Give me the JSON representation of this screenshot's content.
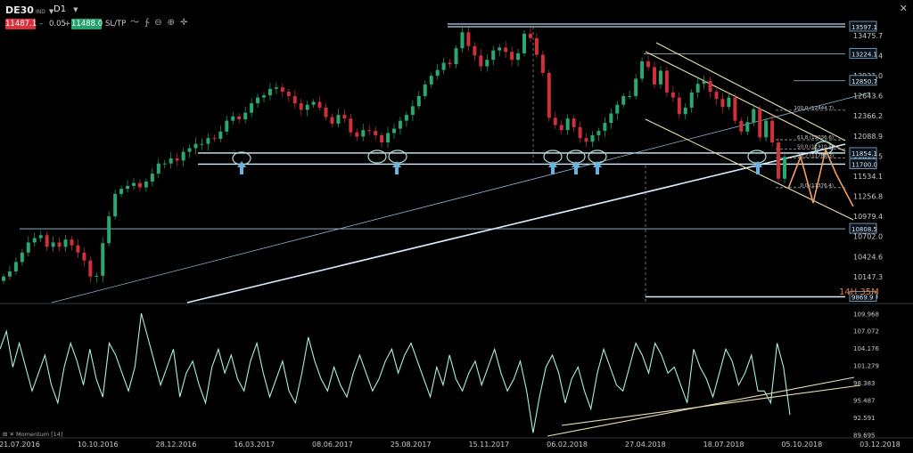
{
  "toolbar": {
    "symbol": "DE30",
    "symbol_suffix": "IND",
    "timeframe": "D1",
    "sell_price": "11487.1",
    "spread": "0.05",
    "buy_price": "11488.0",
    "sltp_label": "SL/TP",
    "minus": "–",
    "plus": "+",
    "close": "✕"
  },
  "countdown": "14H 35M",
  "indicator_label": "Momentum [14]",
  "chart_data": [
    {
      "type": "line",
      "name": "price",
      "ylim": [
        9790,
        13720
      ],
      "y_ticks": [
        13475.7,
        13198.4,
        12921.0,
        12643.6,
        12366.2,
        12088.9,
        11811.5,
        11534.1,
        11256.8,
        10979.4,
        10702.0,
        10424.6,
        10147.3,
        9869.9
      ],
      "y_tick_labels": [
        "13475.7",
        "13198.4",
        "12921.0",
        "12643.6",
        "12366.2",
        "12088.9",
        "11811.5",
        "11534.1",
        "11256.8",
        "10979.4",
        "10702.0",
        "10424.6",
        "10147.3",
        "9869.9"
      ],
      "x_ticks": [
        "21.07.2016",
        "10.10.2016",
        "28.12.2016",
        "16.03.2017",
        "08.06.2017",
        "25.08.2017",
        "15.11.2017",
        "06.02.2018",
        "27.04.2018",
        "18.07.2018",
        "05.10.2018",
        "03.12.2018"
      ],
      "candle_closes": [
        10150,
        10220,
        10350,
        10480,
        10620,
        10680,
        10720,
        10560,
        10620,
        10560,
        10660,
        10580,
        10480,
        10370,
        10150,
        10160,
        10610,
        10980,
        11290,
        11360,
        11400,
        11440,
        11380,
        11460,
        11570,
        11710,
        11710,
        11780,
        11750,
        11870,
        11920,
        11980,
        11980,
        12060,
        12050,
        12150,
        12300,
        12360,
        12320,
        12410,
        12540,
        12620,
        12650,
        12740,
        12760,
        12700,
        12640,
        12540,
        12450,
        12520,
        12560,
        12480,
        12350,
        12260,
        12380,
        12330,
        12140,
        12080,
        12170,
        12160,
        12100,
        12000,
        12130,
        12190,
        12300,
        12380,
        12500,
        12640,
        12800,
        12920,
        13000,
        13100,
        13080,
        13300,
        13520,
        13330,
        13200,
        13050,
        13140,
        13270,
        13310,
        13250,
        13140,
        13230,
        13500,
        13440,
        13210,
        12960,
        12340,
        12240,
        12170,
        12330,
        12210,
        12060,
        12010,
        12100,
        12160,
        12270,
        12400,
        12520,
        12640,
        12640,
        12880,
        13120,
        13040,
        12800,
        12990,
        12690,
        12620,
        12390,
        12480,
        12690,
        12810,
        12850,
        12700,
        12600,
        12490,
        12620,
        12300,
        12150,
        12280,
        12460,
        12070,
        12300,
        12000,
        11500,
        11800
      ],
      "price_levels": [
        13597.1,
        13224.1,
        12850.7,
        12444.7,
        12036.6,
        11854.1,
        11700.0,
        11376.4,
        10808.5,
        9869.9
      ],
      "price_level_labels": [
        "13597.1",
        "13224.1",
        "12850.7",
        "11854.1",
        "11700.0",
        "10808.5",
        "9869.9"
      ],
      "fibonacci": [
        {
          "label": "100.0 (12444.7)",
          "value": 12444.7
        },
        {
          "label": "61.8 (12036.6)",
          "value": 12036.6
        },
        {
          "label": "50.0 (11910.5)",
          "value": 11910.5
        },
        {
          "label": "38.2 (11784.3)",
          "value": 11784.3
        },
        {
          "label": "0.0 (11376.4)",
          "value": 11376.4
        }
      ]
    },
    {
      "type": "line",
      "name": "Momentum [14]",
      "ylim": [
        89.3,
        111.2
      ],
      "y_ticks": [
        109.968,
        107.072,
        104.176,
        101.279,
        98.383,
        95.487,
        92.591,
        89.695
      ],
      "y_tick_labels": [
        "109.968",
        "107.072",
        "104.176",
        "101.279",
        "98.383",
        "95.487",
        "92.591",
        "89.695"
      ],
      "values": [
        104,
        107,
        101,
        105,
        101,
        97,
        100,
        103,
        98,
        95,
        101,
        105,
        102,
        98,
        104,
        99,
        96,
        105,
        103,
        100,
        97,
        101,
        110,
        106,
        102,
        98,
        101,
        104,
        96,
        100,
        102,
        98,
        95,
        101,
        104,
        100,
        103,
        99,
        97,
        102,
        105,
        100,
        96,
        99,
        102,
        97,
        95,
        100,
        106,
        102,
        99,
        97,
        101,
        98,
        96,
        100,
        103,
        100,
        97,
        99,
        102,
        104,
        100,
        103,
        105,
        102,
        99,
        96,
        101,
        98,
        103,
        99,
        97,
        100,
        102,
        98,
        101,
        104,
        100,
        97,
        99,
        102,
        97,
        90,
        96,
        101,
        103,
        100,
        95,
        99,
        101,
        97,
        94,
        100,
        104,
        101,
        98,
        97,
        101,
        105,
        103,
        100,
        105,
        103,
        100,
        101,
        98,
        95,
        104,
        101,
        99,
        96,
        100,
        104,
        102,
        98,
        100,
        103,
        97,
        97,
        95,
        105,
        101,
        93
      ]
    }
  ]
}
